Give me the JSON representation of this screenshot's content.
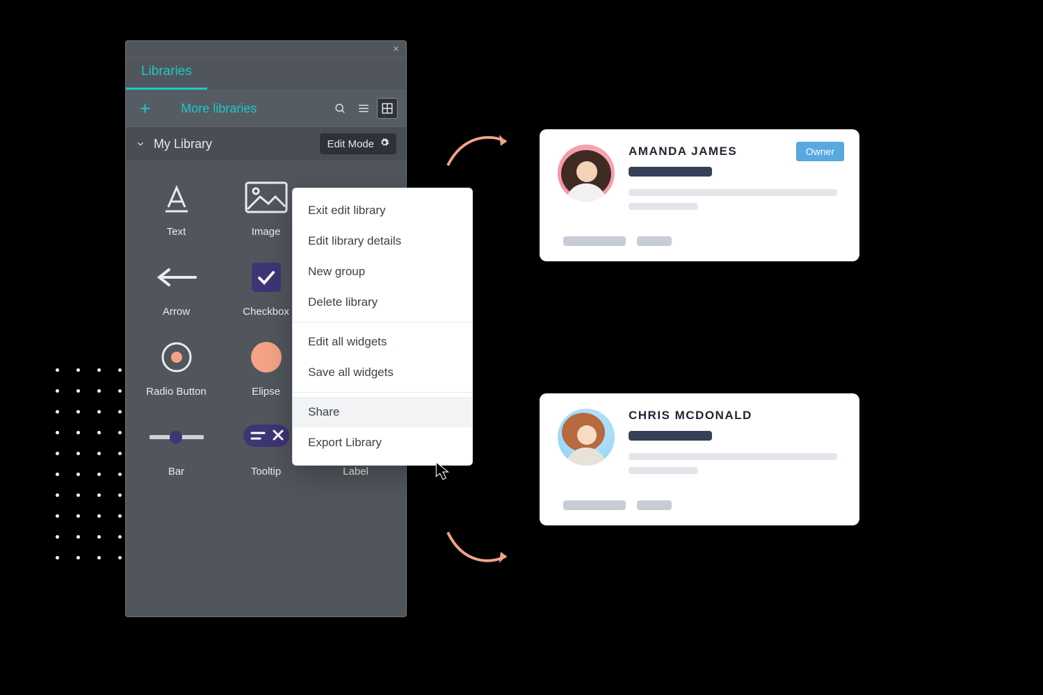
{
  "panel": {
    "tab_label": "Libraries",
    "more_label": "More libraries",
    "section_title": "My Library",
    "editmode_label": "Edit Mode",
    "widgets": [
      {
        "label": "Text"
      },
      {
        "label": "Image"
      },
      {
        "label": "Arrow"
      },
      {
        "label": "Checkbox"
      },
      {
        "label": "Radio Button"
      },
      {
        "label": "Elipse"
      },
      {
        "label": "Bar"
      },
      {
        "label": "Tooltip"
      },
      {
        "label": "Label"
      }
    ]
  },
  "menu": {
    "items": [
      {
        "label": "Exit edit library"
      },
      {
        "label": "Edit library details"
      },
      {
        "label": "New group"
      },
      {
        "label": "Delete library"
      }
    ],
    "items2": [
      {
        "label": "Edit all widgets"
      },
      {
        "label": "Save all widgets"
      }
    ],
    "items3": [
      {
        "label": "Share"
      },
      {
        "label": "Export Library"
      }
    ]
  },
  "cards": {
    "c1": {
      "name": "AMANDA JAMES",
      "badge": "Owner"
    },
    "c2": {
      "name": "CHRIS MCDONALD"
    }
  }
}
